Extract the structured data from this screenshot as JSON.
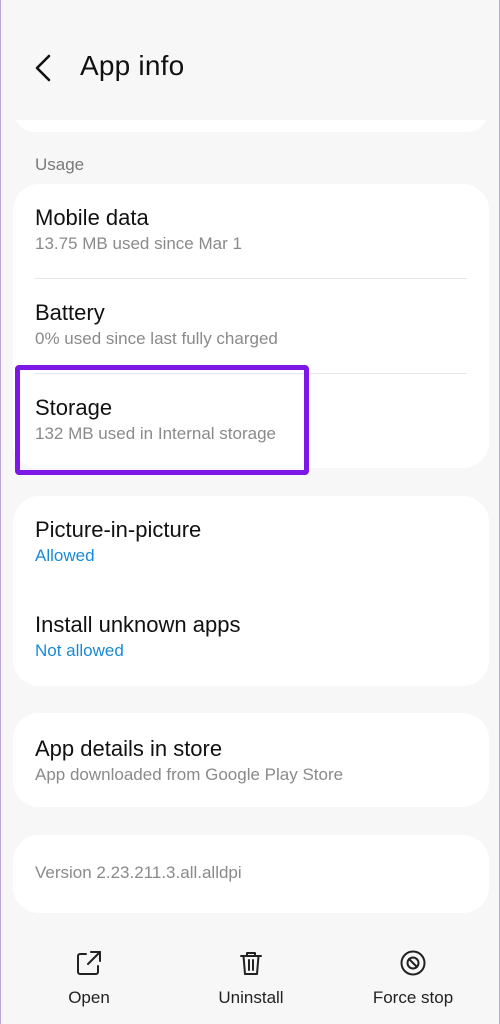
{
  "header": {
    "title": "App info"
  },
  "usage": {
    "section_label": "Usage",
    "items": [
      {
        "title": "Mobile data",
        "subtitle": "13.75 MB used since Mar 1"
      },
      {
        "title": "Battery",
        "subtitle": "0% used since last fully charged"
      },
      {
        "title": "Storage",
        "subtitle": "132 MB used in Internal storage"
      }
    ]
  },
  "permissions": {
    "items": [
      {
        "title": "Picture-in-picture",
        "subtitle": "Allowed"
      },
      {
        "title": "Install unknown apps",
        "subtitle": "Not allowed"
      }
    ]
  },
  "store": {
    "title": "App details in store",
    "subtitle": "App downloaded from Google Play Store"
  },
  "version": {
    "text": "Version 2.23.211.3.all.alldpi"
  },
  "bottom_actions": [
    {
      "label": "Open",
      "icon": "open-external-icon"
    },
    {
      "label": "Uninstall",
      "icon": "trash-icon"
    },
    {
      "label": "Force stop",
      "icon": "force-stop-icon"
    }
  ],
  "colors": {
    "highlight": "#7d17e6",
    "link": "#1a8ad6",
    "background": "#f7f7f7"
  }
}
